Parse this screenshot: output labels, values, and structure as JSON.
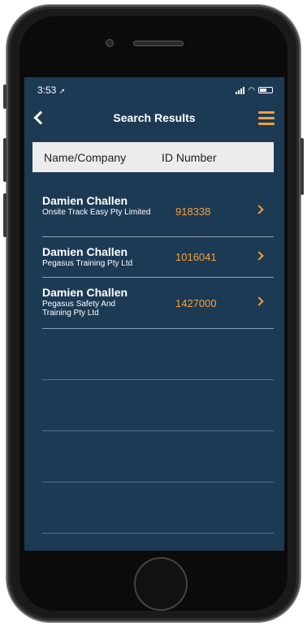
{
  "status_bar": {
    "time": "3:53",
    "location_icon": "location-arrow-icon"
  },
  "nav": {
    "title": "Search Results",
    "back_icon": "chevron-left-icon",
    "menu_icon": "hamburger-menu-icon"
  },
  "table_header": {
    "name_col": "Name/Company",
    "id_col": "ID Number"
  },
  "results": [
    {
      "name": "Damien Challen",
      "company": "Onsite Track Easy Pty Limited",
      "id": "918338"
    },
    {
      "name": "Damien Challen",
      "company": "Pegasus Training Pty Ltd",
      "id": "1016041"
    },
    {
      "name": "Damien Challen",
      "company": "Pegasus Safety And Training Pty Ltd",
      "id": "1427000"
    }
  ],
  "colors": {
    "background": "#1d3a55",
    "accent": "#f0a23b",
    "header_bg": "#ececec"
  }
}
